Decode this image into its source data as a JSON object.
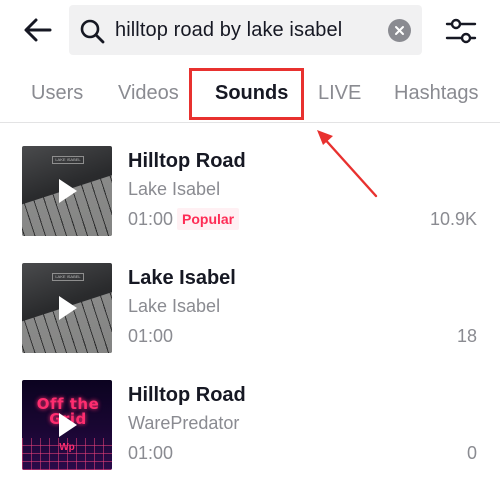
{
  "header": {
    "search_query": "hilltop road by lake isabel"
  },
  "tabs": [
    {
      "label": "Users",
      "active": false
    },
    {
      "label": "Videos",
      "active": false
    },
    {
      "label": "Sounds",
      "active": true
    },
    {
      "label": "LIVE",
      "active": false
    },
    {
      "label": "Hashtags",
      "active": false
    }
  ],
  "sounds": [
    {
      "title": "Hilltop Road",
      "artist": "Lake Isabel",
      "duration": "01:00",
      "badge": "Popular",
      "count": "10.9K",
      "cover": "piano-keys"
    },
    {
      "title": "Lake Isabel",
      "artist": "Lake Isabel",
      "duration": "01:00",
      "badge": "",
      "count": "18",
      "cover": "piano-keys"
    },
    {
      "title": "Hilltop Road",
      "artist": "WarePredator",
      "duration": "01:00",
      "badge": "",
      "count": "0",
      "cover": "neon-grid"
    }
  ],
  "cover_art": {
    "neon_text": "Off the Grid",
    "neon_sub": "Wp",
    "piano_tag": "LAKE ISABEL"
  },
  "colors": {
    "accent": "#fe2c55",
    "annotation": "#e8312f",
    "muted_text": "#8a8b91",
    "primary_text": "#161823"
  },
  "icons": {
    "back": "arrow-left-icon",
    "search": "search-icon",
    "clear": "clear-x-icon",
    "filter": "sliders-icon",
    "play": "play-icon"
  }
}
